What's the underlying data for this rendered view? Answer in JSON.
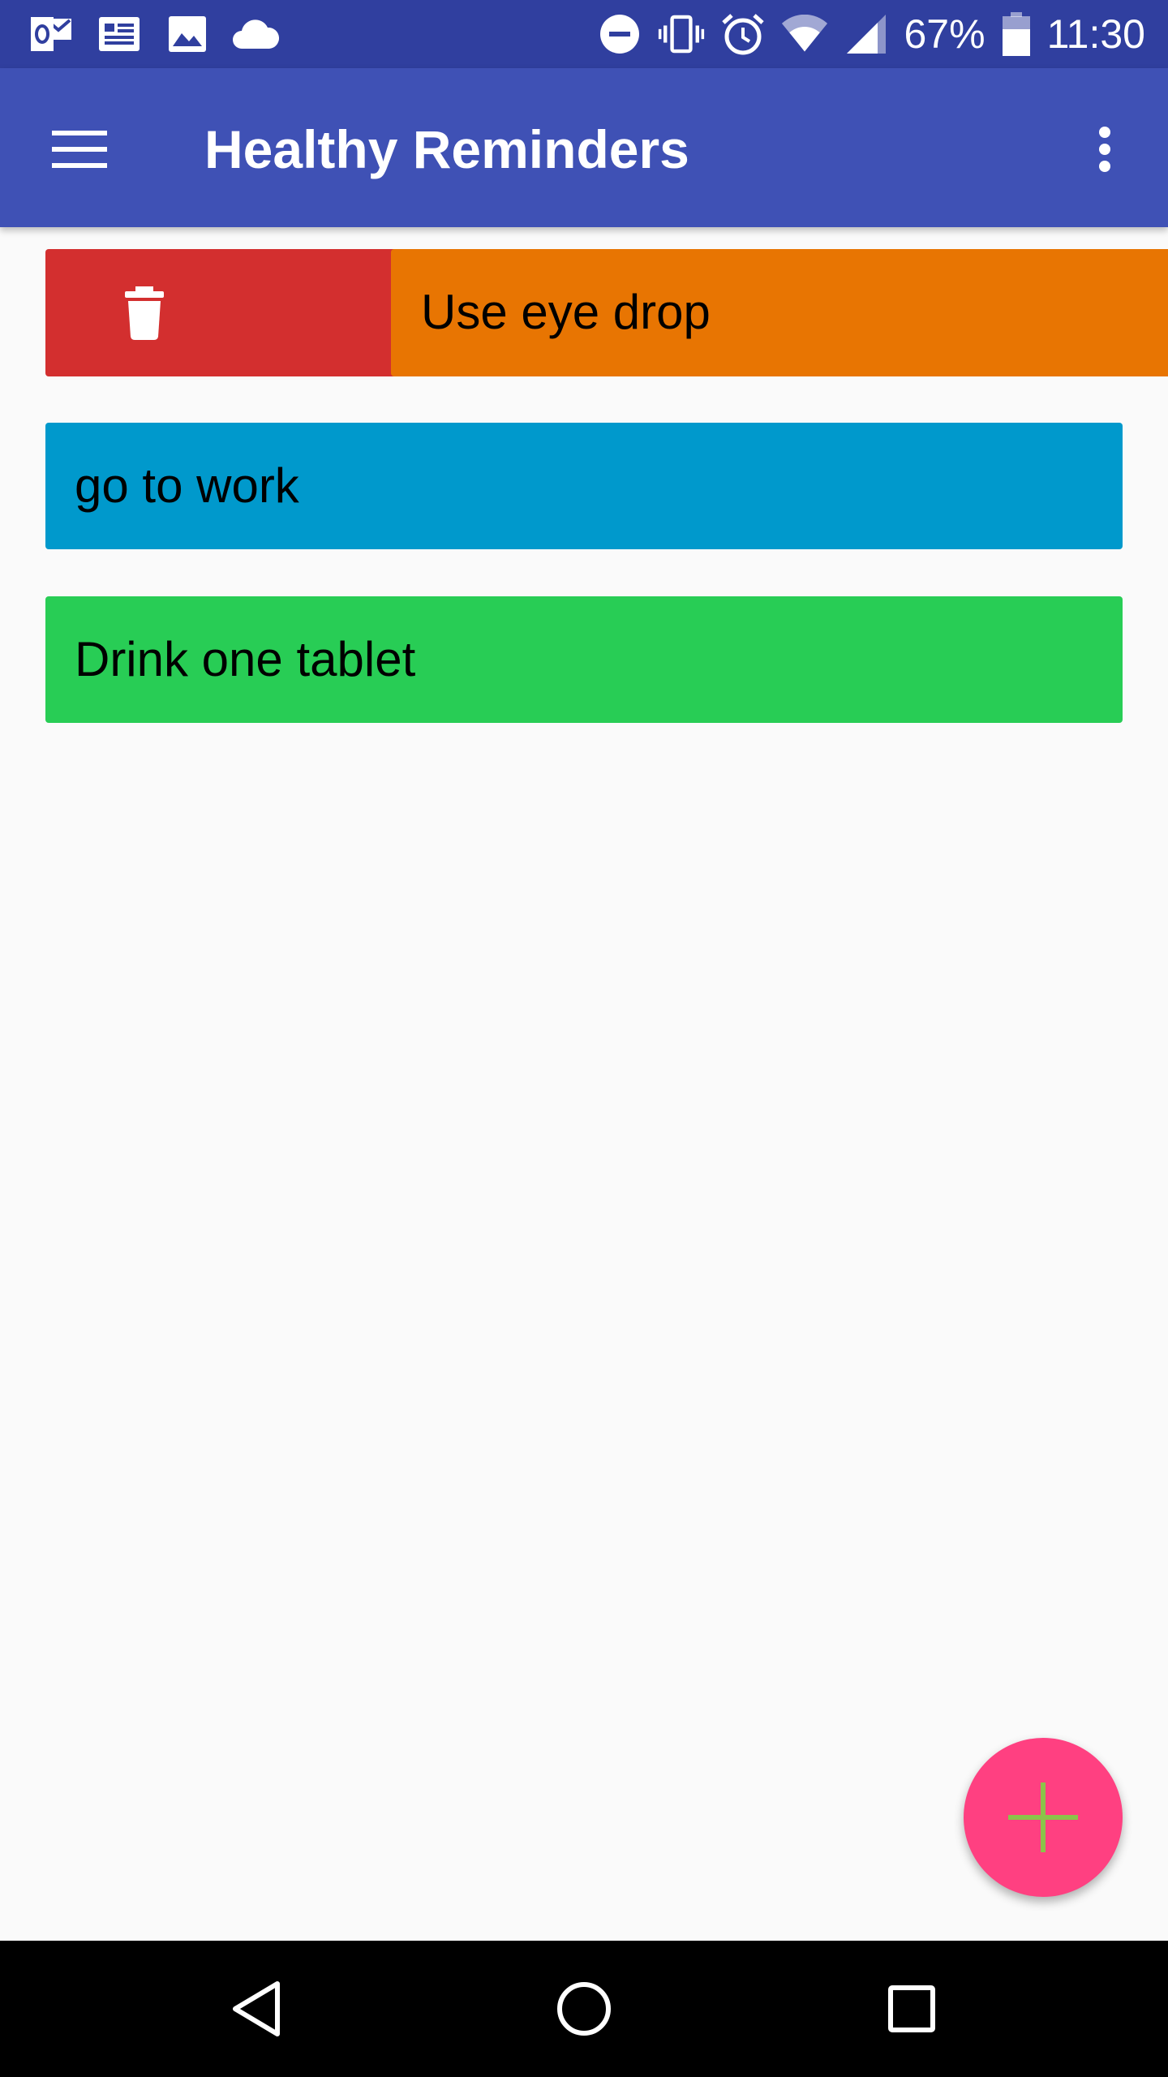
{
  "status_bar": {
    "left_icons": [
      "outlook-icon",
      "news-icon",
      "image-icon",
      "cloud-icon"
    ],
    "right_icons": [
      "do-not-disturb-icon",
      "vibrate-icon",
      "alarm-icon",
      "wifi-icon",
      "cell-signal-icon"
    ],
    "battery_percent": "67%",
    "time": "11:30",
    "background_color": "#303f9f"
  },
  "app_bar": {
    "title": "Healthy Reminders",
    "menu_icon": "hamburger-menu-icon",
    "overflow_icon": "more-vert-icon",
    "background_color": "#3f51b5"
  },
  "reminders": [
    {
      "label": "Use eye drop",
      "color": "#e87502",
      "swiped": true,
      "delete_color": "#d32f2f"
    },
    {
      "label": "go to work",
      "color": "#0099cc",
      "swiped": false
    },
    {
      "label": "Drink one tablet",
      "color": "#28cd55",
      "swiped": false
    }
  ],
  "fab": {
    "icon": "plus-icon",
    "color": "#ff4081",
    "icon_color": "#8bc34a"
  },
  "nav_bar": {
    "icons": [
      "back-icon",
      "home-icon",
      "recents-icon"
    ]
  }
}
